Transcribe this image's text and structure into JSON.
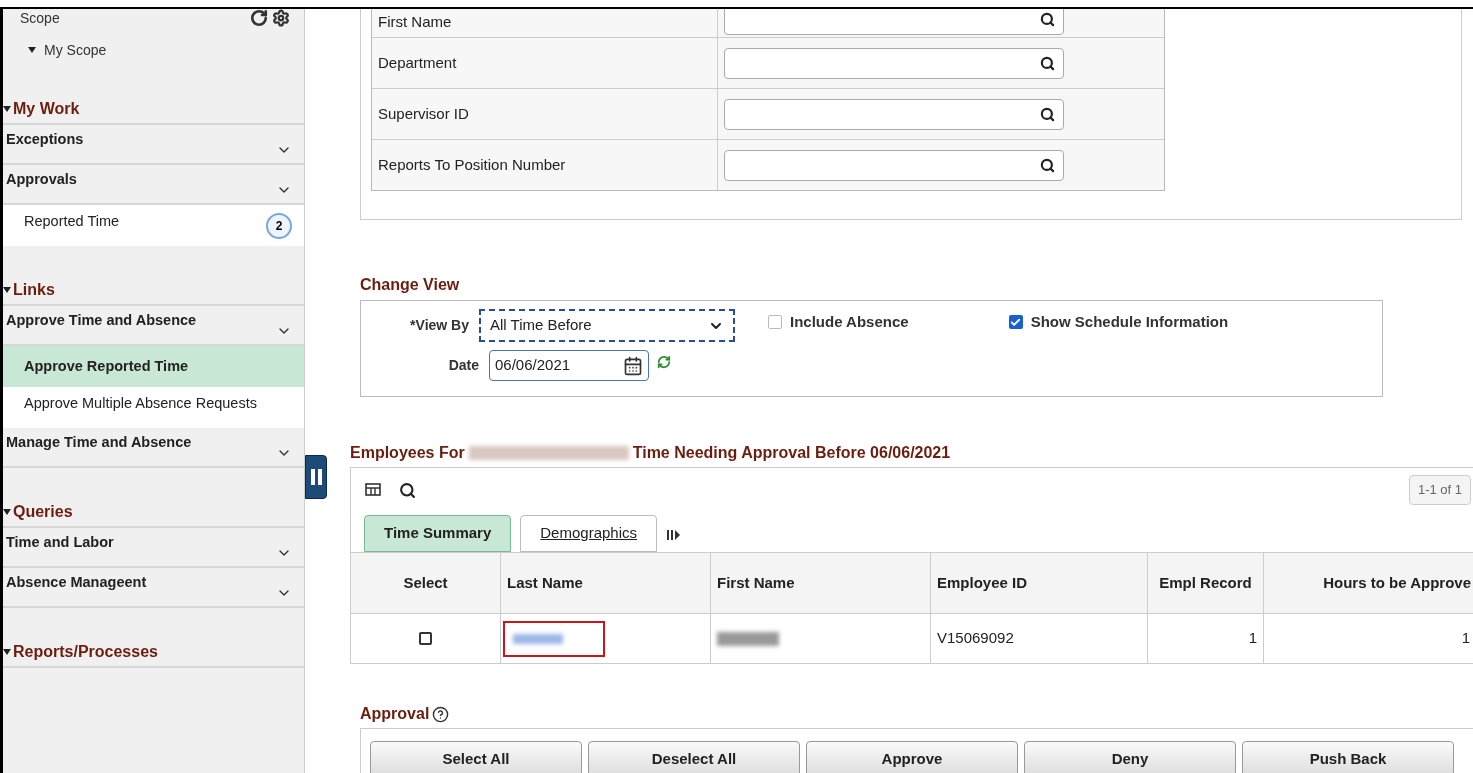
{
  "sidebar": {
    "scope_title": "Scope",
    "scope_item": {
      "label": "My Scope",
      "expanded": true
    },
    "sections": [
      {
        "title": "My Work",
        "expanded": true,
        "groups": [
          {
            "label": "Exceptions"
          },
          {
            "label": "Approvals",
            "items": [
              {
                "label": "Reported Time",
                "selected": false,
                "badge": "2"
              }
            ]
          }
        ]
      },
      {
        "title": "Links",
        "expanded": true,
        "groups": [
          {
            "label": "Approve Time and Absence",
            "items": [
              {
                "label": "Approve Reported Time",
                "selected": true
              },
              {
                "label": "Approve Multiple Absence Requests",
                "selected": false
              }
            ]
          },
          {
            "label": "Manage Time and Absence"
          }
        ]
      },
      {
        "title": "Queries",
        "expanded": true,
        "groups": [
          {
            "label": "Time and Labor"
          },
          {
            "label": "Absence Manageent"
          }
        ]
      },
      {
        "title": "Reports/Processes",
        "expanded": true
      }
    ]
  },
  "search_criteria": [
    {
      "label": "First Name"
    },
    {
      "label": "Department"
    },
    {
      "label": "Supervisor ID"
    },
    {
      "label": "Reports To Position Number"
    }
  ],
  "change_view": {
    "title": "Change View",
    "view_by": {
      "label": "*View By",
      "value": "All Time Before"
    },
    "date": {
      "label": "Date",
      "value": "06/06/2021"
    },
    "checkboxes": [
      {
        "label": "Include Absence",
        "checked": false
      },
      {
        "label": "Show Schedule Information",
        "checked": true
      }
    ]
  },
  "employees": {
    "title_start": "Employees For",
    "title_end": "Time Needing Approval Before 06/06/2021",
    "pagination": "1-1 of 1",
    "tabs": [
      {
        "label": "Time Summary",
        "selected": true
      },
      {
        "label": "Demographics",
        "selected": false
      }
    ],
    "columns": [
      "Select",
      "Last Name",
      "First Name",
      "Employee ID",
      "Empl Record",
      "Hours to be Approve"
    ],
    "rows": [
      {
        "checked": false,
        "employee_id": "V15069092",
        "empl_record": "1",
        "hours": "1"
      }
    ]
  },
  "approval": {
    "title": "Approval",
    "buttons": [
      "Select All",
      "Deselect All",
      "Approve",
      "Deny",
      "Push Back"
    ]
  }
}
